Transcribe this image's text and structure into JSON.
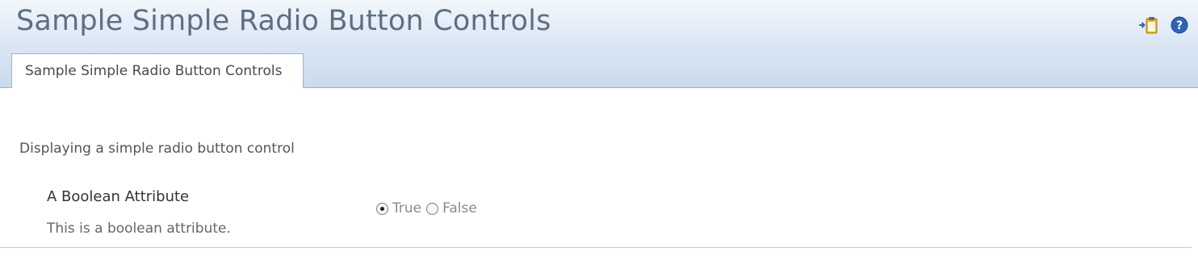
{
  "page": {
    "title": "Sample Simple Radio Button Controls"
  },
  "toolbar": {
    "icons": [
      "add-clipboard-icon",
      "help-icon"
    ],
    "colors": {
      "clipboard": "#e8b92f",
      "help": "#2f63b7"
    }
  },
  "tabs": [
    {
      "label": "Sample Simple Radio Button Controls",
      "selected": true
    }
  ],
  "section": {
    "description": "Displaying a simple radio button control"
  },
  "field": {
    "label": "A Boolean Attribute",
    "help": "This is a boolean attribute.",
    "options": [
      {
        "label": "True",
        "selected": true
      },
      {
        "label": "False",
        "selected": false
      }
    ]
  },
  "theme": {
    "header_gradient_top": "#f3f7fc",
    "header_gradient_bottom": "#c9daee",
    "border": "#9fb4cc"
  }
}
